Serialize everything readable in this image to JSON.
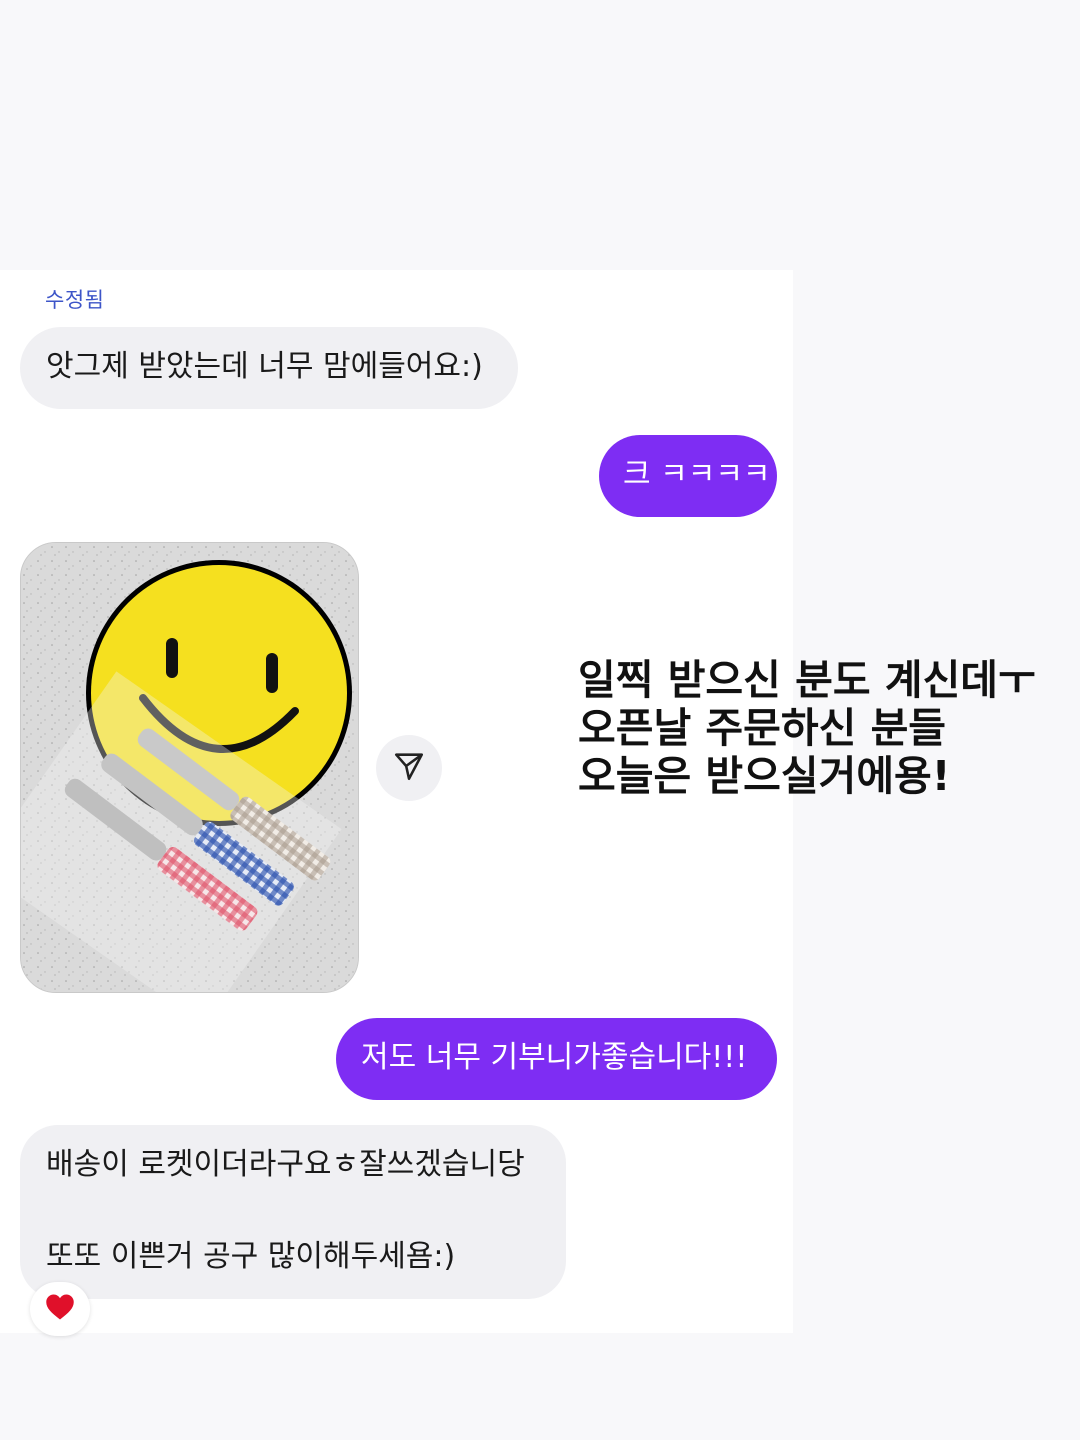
{
  "chat": {
    "edited_label": "수정됨",
    "messages": [
      {
        "side": "incoming",
        "text": "앗그제 받았는데 너무 맘에들어요:)"
      },
      {
        "side": "outgoing",
        "text": "크 ㅋㅋㅋㅋ"
      },
      {
        "side": "outgoing",
        "text": "저도 너무 기부니가좋습니다!!!"
      },
      {
        "side": "incoming",
        "lines": [
          "배송이 로켓이더라구요ㅎ잘쓰겠습니당",
          "또또 이쁜거 공구 많이해두세욤:)"
        ]
      }
    ],
    "reaction": "heart",
    "photo_icon": "share-icon"
  },
  "overlay": {
    "lines": [
      "일찍 받으신 분도 계신데ㅜ",
      "오픈날 주문하신 분들",
      "오늘은 받으실거에용!"
    ]
  },
  "colors": {
    "outgoing_bubble": "#7e2df3",
    "incoming_bubble": "#f0f0f3",
    "edited_label": "#3d55c8",
    "reaction_heart": "#e0102a"
  }
}
